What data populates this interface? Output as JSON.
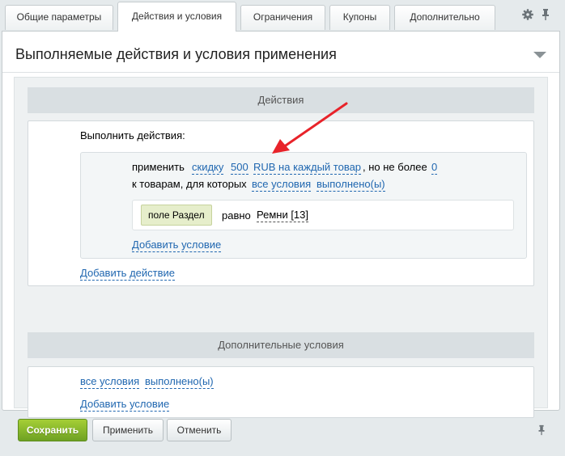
{
  "tabs": [
    {
      "label": "Общие параметры"
    },
    {
      "label": "Действия и условия",
      "active": true
    },
    {
      "label": "Ограничения"
    },
    {
      "label": "Купоны"
    },
    {
      "label": "Дополнительно"
    }
  ],
  "tab_icons": [
    "gear-icon",
    "pin-icon"
  ],
  "main": {
    "title": "Выполняемые действия и условия применения",
    "actions_section": {
      "header": "Действия",
      "perform_label": "Выполнить действия:",
      "rule": {
        "apply": "применить",
        "action_type": "скидку",
        "amount": "500",
        "unit": "RUB на каждый товар",
        "limit_text": ", но не более",
        "limit_value": "0",
        "goods_text": "к товарам, для которых",
        "all_conditions": "все условия",
        "fulfilled": "выполнено(ы)"
      },
      "condition": {
        "field": "поле Раздел",
        "operator": "равно",
        "value": "Ремни [13]"
      },
      "add_condition": "Добавить условие",
      "add_action": "Добавить действие"
    },
    "extra_section": {
      "header": "Дополнительные условия",
      "all_conditions": "все условия",
      "fulfilled": "выполнено(ы)",
      "add_condition": "Добавить условие"
    }
  },
  "footer": {
    "save": "Сохранить",
    "apply": "Применить",
    "cancel": "Отменить"
  },
  "colors": {
    "accent_link": "#2067b0",
    "save_button": "#7cb02a",
    "annotation_arrow": "#e8232a",
    "field_chip": "#e6eecb"
  }
}
